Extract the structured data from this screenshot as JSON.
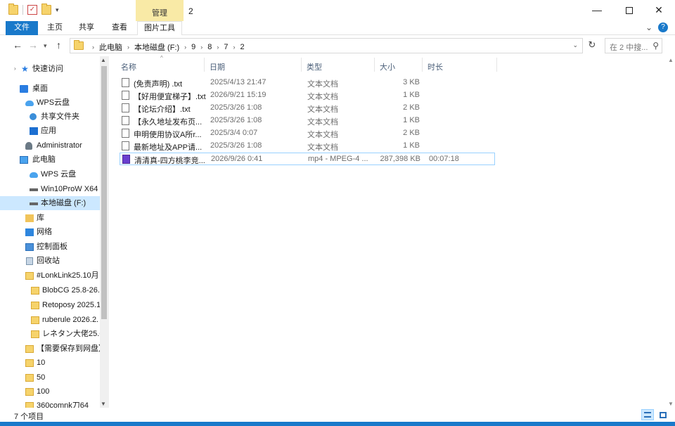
{
  "titlebar": {
    "context_tab": "管理",
    "title": "2",
    "minimize": "—",
    "close": "✕"
  },
  "ribbon": {
    "tabs": [
      "文件",
      "主页",
      "共享",
      "查看",
      "图片工具"
    ]
  },
  "address": {
    "crumbs": [
      "此电脑",
      "本地磁盘 (F:)",
      "9",
      "8",
      "7",
      "2"
    ],
    "search_placeholder": "在 2 中搜..."
  },
  "nav": {
    "items": [
      {
        "label": "快速访问",
        "icon": "star-icon"
      },
      {
        "label": "桌面",
        "icon": "desktop-icon"
      },
      {
        "label": "WPS云盘",
        "icon": "cloud-icon"
      },
      {
        "label": "共享文件夹",
        "icon": "shared-folder-icon"
      },
      {
        "label": "应用",
        "icon": "apps-icon"
      },
      {
        "label": "Administrator",
        "icon": "user-icon"
      },
      {
        "label": "此电脑",
        "icon": "computer-icon"
      },
      {
        "label": "WPS 云盘",
        "icon": "cloud-icon"
      },
      {
        "label": "Win10ProW X64",
        "icon": "drive-icon"
      },
      {
        "label": "本地磁盘 (F:)",
        "icon": "drive-icon",
        "selected": true
      },
      {
        "label": "库",
        "icon": "library-icon"
      },
      {
        "label": "网络",
        "icon": "network-icon"
      },
      {
        "label": "控制面板",
        "icon": "control-panel-icon"
      },
      {
        "label": "回收站",
        "icon": "recycle-bin-icon"
      },
      {
        "label": "#LonkLink25.10月",
        "icon": "folder-icon"
      },
      {
        "label": "BlobCG 25.8-26.",
        "icon": "folder-icon"
      },
      {
        "label": "Retoposy 2025.1",
        "icon": "folder-icon"
      },
      {
        "label": "ruberule 2026.2.",
        "icon": "folder-icon"
      },
      {
        "label": "レネタン大佬25.6",
        "icon": "folder-icon"
      },
      {
        "label": "【需要保存到网盘】",
        "icon": "folder-icon"
      },
      {
        "label": "10",
        "icon": "folder-icon"
      },
      {
        "label": "50",
        "icon": "folder-icon"
      },
      {
        "label": "100",
        "icon": "folder-icon"
      },
      {
        "label": "360comnk刀64",
        "icon": "folder-icon"
      }
    ]
  },
  "list": {
    "columns": [
      "名称",
      "日期",
      "类型",
      "大小",
      "时长"
    ],
    "rows": [
      {
        "name": "(免责声明) .txt",
        "date": "2025/4/13 21:47",
        "type": "文本文档",
        "size": "3 KB",
        "duration": "",
        "icon": "text-file-icon"
      },
      {
        "name": "【好用便宜梯子】.txt",
        "date": "2026/9/21 15:19",
        "type": "文本文档",
        "size": "1 KB",
        "duration": "",
        "icon": "text-file-icon"
      },
      {
        "name": "【论坛介绍】.txt",
        "date": "2025/3/26 1:08",
        "type": "文本文档",
        "size": "2 KB",
        "duration": "",
        "icon": "text-file-icon"
      },
      {
        "name": "【永久地址发布页...",
        "date": "2025/3/26 1:08",
        "type": "文本文档",
        "size": "1 KB",
        "duration": "",
        "icon": "text-file-icon"
      },
      {
        "name": "申明使用协议A所r...",
        "date": "2025/3/4 0:07",
        "type": "文本文档",
        "size": "2 KB",
        "duration": "",
        "icon": "text-file-icon"
      },
      {
        "name": "最新地址及APP请...",
        "date": "2025/3/26 1:08",
        "type": "文本文档",
        "size": "1 KB",
        "duration": "",
        "icon": "text-file-icon"
      },
      {
        "name": "清清真-四方桃李竞...",
        "date": "2026/9/26 0:41",
        "type": "mp4 - MPEG-4 ...",
        "size": "287,398 KB",
        "duration": "00:07:18",
        "icon": "video-file-icon",
        "selected": true
      }
    ]
  },
  "status": {
    "count": "7 个项目"
  }
}
